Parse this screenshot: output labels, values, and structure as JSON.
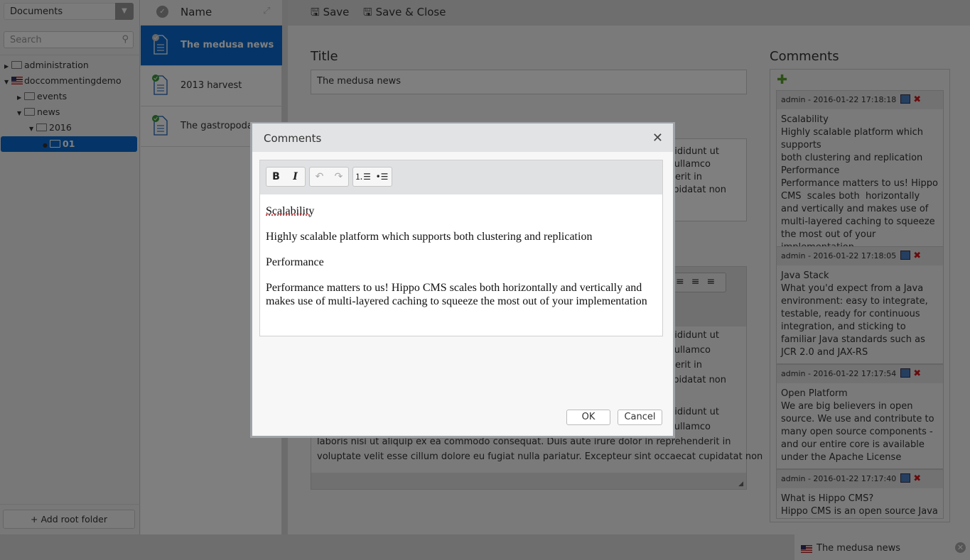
{
  "sidebar": {
    "dropdown": "Documents",
    "search_placeholder": "Search",
    "tree": [
      {
        "label": "administration",
        "state": "collapsed"
      },
      {
        "label": "doccommentingdemo",
        "state": "expanded"
      },
      {
        "label": "events",
        "state": "collapsed"
      },
      {
        "label": "news",
        "state": "expanded"
      },
      {
        "label": "2016",
        "state": "expanded"
      },
      {
        "label": "01",
        "state": "selected"
      }
    ],
    "add_root": "+ Add root folder"
  },
  "list": {
    "header": "Name",
    "items": [
      {
        "title": "The medusa news",
        "selected": true
      },
      {
        "title": "2013 harvest"
      },
      {
        "title": "The gastropoda"
      }
    ]
  },
  "toolbar": {
    "save": "Save",
    "save_close": "Save & Close"
  },
  "editor": {
    "title_label": "Title",
    "title_value": "The medusa news",
    "field1_fragments": [
      "cididunt ut",
      "ullamco",
      "derit in",
      "upidatat non"
    ],
    "field2_fragments": [
      "cididunt ut",
      "ullamco",
      "derit in",
      "upidatat non"
    ],
    "field3_fragments": [
      "cididunt ut",
      "ullamco"
    ],
    "field3_lines": [
      "laboris nisi ut aliquip ex ea commodo consequat. Duis aute irure dolor in reprehenderit in",
      "voluptate velit esse cillum dolore eu fugiat nulla pariatur. Excepteur sint occaecat cupidatat non"
    ]
  },
  "comments": {
    "heading": "Comments",
    "items": [
      {
        "meta": "admin - 2016-01-22 17:18:18",
        "body": "Scalability\nHighly scalable platform which supports\nboth clustering and replication\nPerformance\nPerformance matters to us! Hippo CMS  scales both  horizontally and vertically and makes use of  multi-layered caching to squeeze the most out of your implementation"
      },
      {
        "meta": "admin - 2016-01-22 17:18:05",
        "body": "Java Stack\nWhat you'd expect from a Java environment: easy to integrate, testable, ready for continuous integration, and sticking to familiar Java standards such as JCR 2.0 and JAX-RS"
      },
      {
        "meta": "admin - 2016-01-22 17:17:54",
        "body": "Open Platform\nWe are big believers in open source. We use and contribute to many open source components - and our entire core is available under the Apache License"
      },
      {
        "meta": "admin - 2016-01-22 17:17:40",
        "body": "What is Hippo CMS?\nHippo CMS is an open source Java"
      }
    ]
  },
  "bottom_tab": {
    "label": "The medusa news"
  },
  "modal": {
    "title": "Comments",
    "paragraphs": [
      "Scalability",
      "Highly scalable platform which supports both clustering and replication",
      "Performance",
      "Performance matters to us! Hippo CMS  scales both  horizontally and vertically and makes use of  multi-layered caching to squeeze the most out of your implementation"
    ],
    "ok": "OK",
    "cancel": "Cancel"
  },
  "colors": {
    "selection": "#0a6ad0",
    "delete": "#d2161b",
    "add": "#5aa02c"
  }
}
